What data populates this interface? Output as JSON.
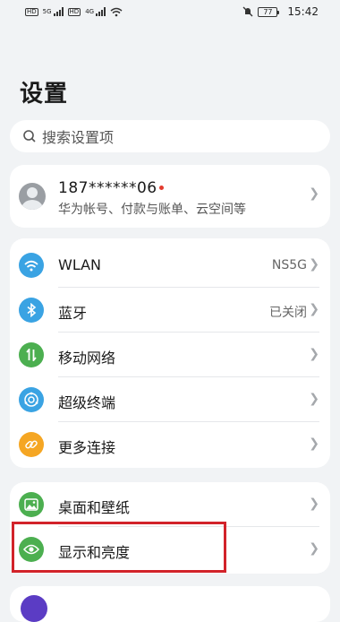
{
  "status_bar": {
    "sim1": "HD",
    "sim2": "HD",
    "net1": "5G",
    "net2": "4G",
    "battery": "77",
    "time": "15:42"
  },
  "page_title": "设置",
  "search": {
    "placeholder": "搜索设置项"
  },
  "account": {
    "name": "187******06",
    "subtitle": "华为帐号、付款与账单、云空间等"
  },
  "group1": [
    {
      "label": "WLAN",
      "value": "NS5G",
      "icon": "wifi-icon",
      "color": "#3aa3e3"
    },
    {
      "label": "蓝牙",
      "value": "已关闭",
      "icon": "bluetooth-icon",
      "color": "#3aa3e3"
    },
    {
      "label": "移动网络",
      "value": "",
      "icon": "mobile-network-icon",
      "color": "#4caf50"
    },
    {
      "label": "超级终端",
      "value": "",
      "icon": "super-device-icon",
      "color": "#3aa3e3"
    },
    {
      "label": "更多连接",
      "value": "",
      "icon": "link-icon",
      "color": "#f5a623"
    }
  ],
  "group2": [
    {
      "label": "桌面和壁纸",
      "icon": "wallpaper-icon",
      "color": "#4caf50"
    },
    {
      "label": "显示和亮度",
      "icon": "eye-icon",
      "color": "#4caf50"
    }
  ],
  "colors": {
    "highlight": "#d2232a",
    "accent_red_dot": "#e33b2e"
  }
}
